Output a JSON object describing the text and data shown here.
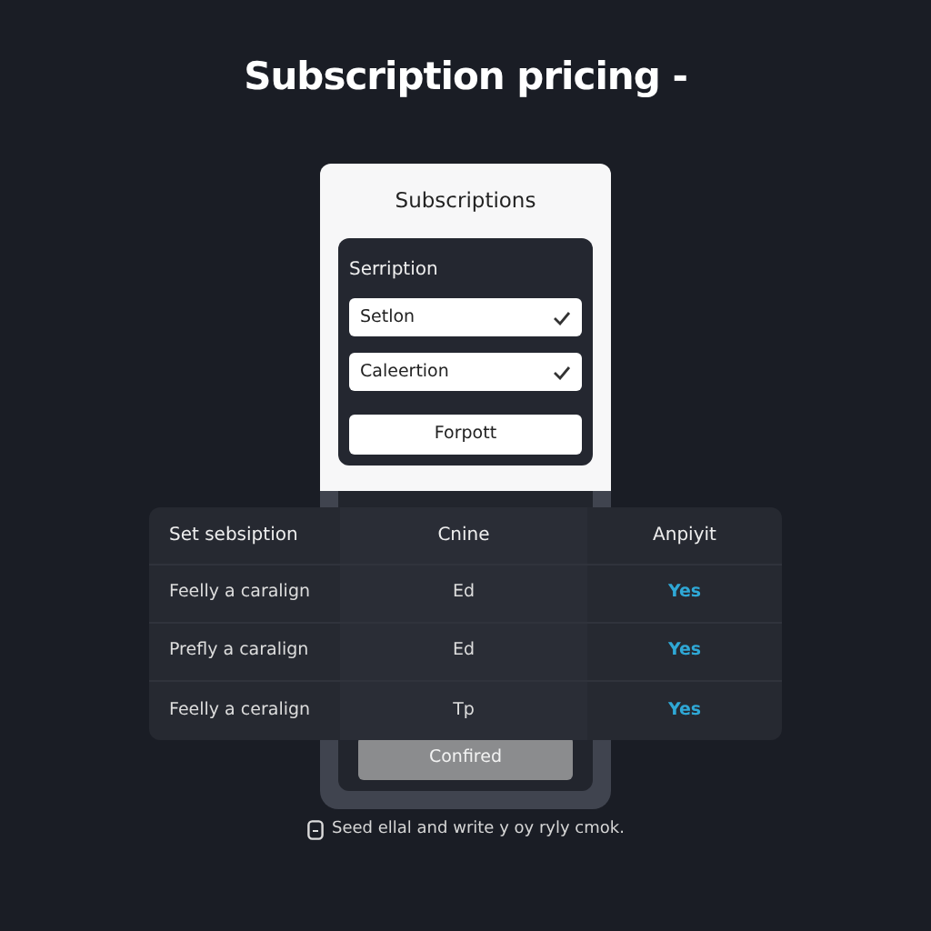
{
  "title": "Subscription pricing -",
  "card": {
    "title": "Subscriptions",
    "panel_label": "Serription",
    "selects": [
      {
        "value": "Setlon",
        "checked": true
      },
      {
        "value": "Caleertion",
        "checked": true
      }
    ],
    "button": "Forpott"
  },
  "table": {
    "columns": [
      "Set sebsiption",
      "Cnine",
      "Anpiyit"
    ],
    "rows": [
      [
        "Feelly a caralign",
        "Ed",
        "Yes"
      ],
      [
        "Prefly a caralign",
        "Ed",
        "Yes"
      ],
      [
        "Feelly a ceralign",
        "Tp",
        "Yes"
      ]
    ]
  },
  "confirm_button": "Confired",
  "footer": "Seed ellal and write y oy ryly cmok."
}
